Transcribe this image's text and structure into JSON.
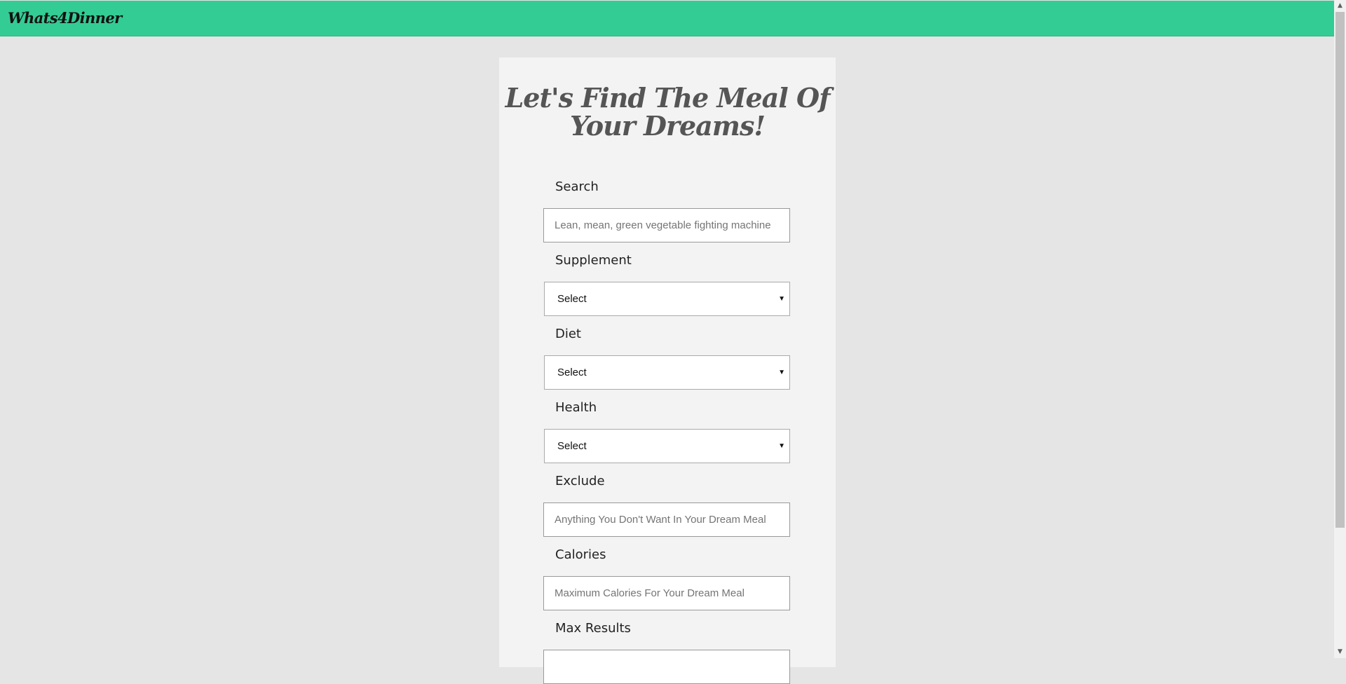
{
  "navbar": {
    "brand": "Whats4Dinner",
    "color": "#33cc94"
  },
  "form": {
    "headline": "Let's Find The Meal Of Your Dreams!",
    "search": {
      "label": "Search",
      "placeholder": "Lean, mean, green vegetable fighting machine"
    },
    "supplement": {
      "label": "Supplement",
      "value": "Select"
    },
    "diet": {
      "label": "Diet",
      "value": "Select"
    },
    "health": {
      "label": "Health",
      "value": "Select"
    },
    "exclude": {
      "label": "Exclude",
      "placeholder": "Anything You Don't Want In Your Dream Meal"
    },
    "calories": {
      "label": "Calories",
      "placeholder": "Maximum Calories For Your Dream Meal"
    },
    "max_results": {
      "label": "Max Results"
    }
  },
  "icons": {
    "dropdown": "chevron-down-icon",
    "scroll_up": "scroll-up-arrow-icon",
    "scroll_down": "scroll-down-arrow-icon"
  }
}
